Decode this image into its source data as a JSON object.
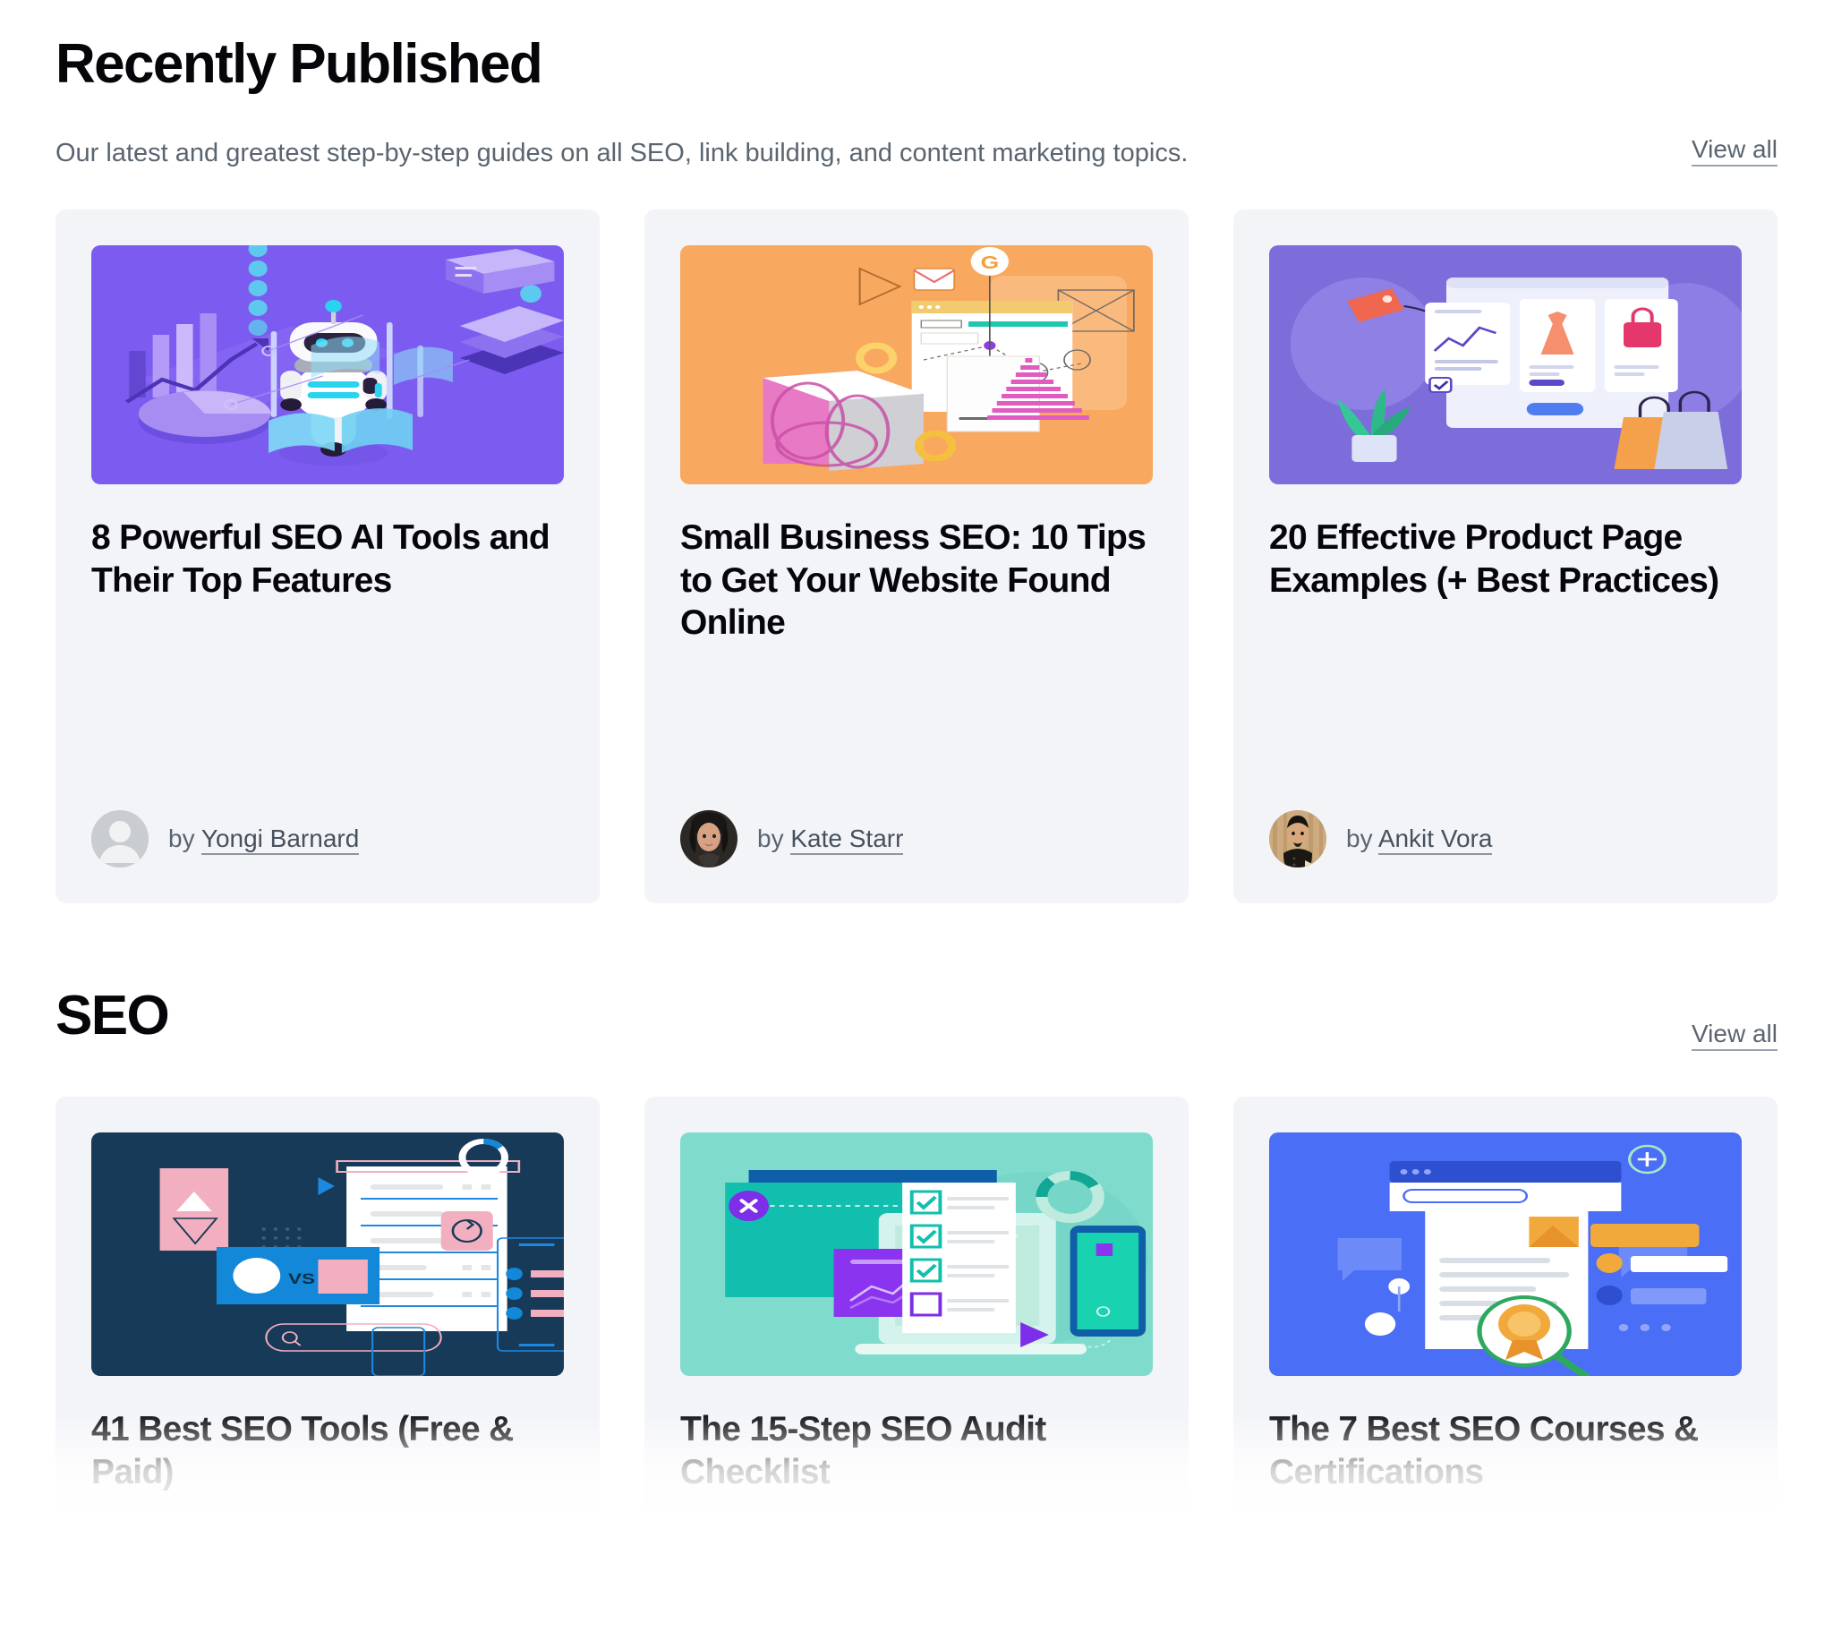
{
  "sections": [
    {
      "id": "recently-published",
      "title": "Recently Published",
      "subtitle": "Our latest and greatest step-by-step guides on all SEO, link building, and content marketing topics.",
      "view_all_label": "View all",
      "cards": [
        {
          "title": "8 Powerful SEO AI Tools and Their Top Features",
          "by_prefix": "by",
          "author": "Yongi Barnard",
          "thumb_name": "ai-robot-analytics-illustration",
          "thumb_bg": "#7c5cf0",
          "avatar_type": "placeholder"
        },
        {
          "title": "Small Business SEO: 10 Tips to Get Your Website Found Online",
          "by_prefix": "by",
          "author": "Kate Starr",
          "thumb_name": "small-business-seo-illustration",
          "thumb_bg": "#f9a860",
          "avatar_type": "photo-dark-hair"
        },
        {
          "title": "20 Effective Product Page Examples (+ Best Practices)",
          "by_prefix": "by",
          "author": "Ankit Vora",
          "thumb_name": "product-page-ecommerce-illustration",
          "thumb_bg": "#7c6ddb",
          "avatar_type": "photo-tan-bg"
        }
      ]
    },
    {
      "id": "seo",
      "title": "SEO",
      "view_all_label": "View all",
      "cards": [
        {
          "title": "41 Best SEO Tools (Free & Paid)",
          "thumb_name": "seo-tools-comparison-illustration",
          "thumb_bg": "#163a57"
        },
        {
          "title": "The 15-Step SEO Audit Checklist",
          "thumb_name": "seo-audit-checklist-illustration",
          "thumb_bg": "#7fdccc"
        },
        {
          "title": "The 7 Best SEO Courses & Certifications",
          "thumb_name": "seo-courses-certification-illustration",
          "thumb_bg": "#4a6ef5"
        }
      ]
    }
  ],
  "colors": {
    "card_bg": "#f3f4f8",
    "text_primary": "#05050a",
    "text_muted": "#5a6570",
    "page_bg": "#ffffff"
  }
}
